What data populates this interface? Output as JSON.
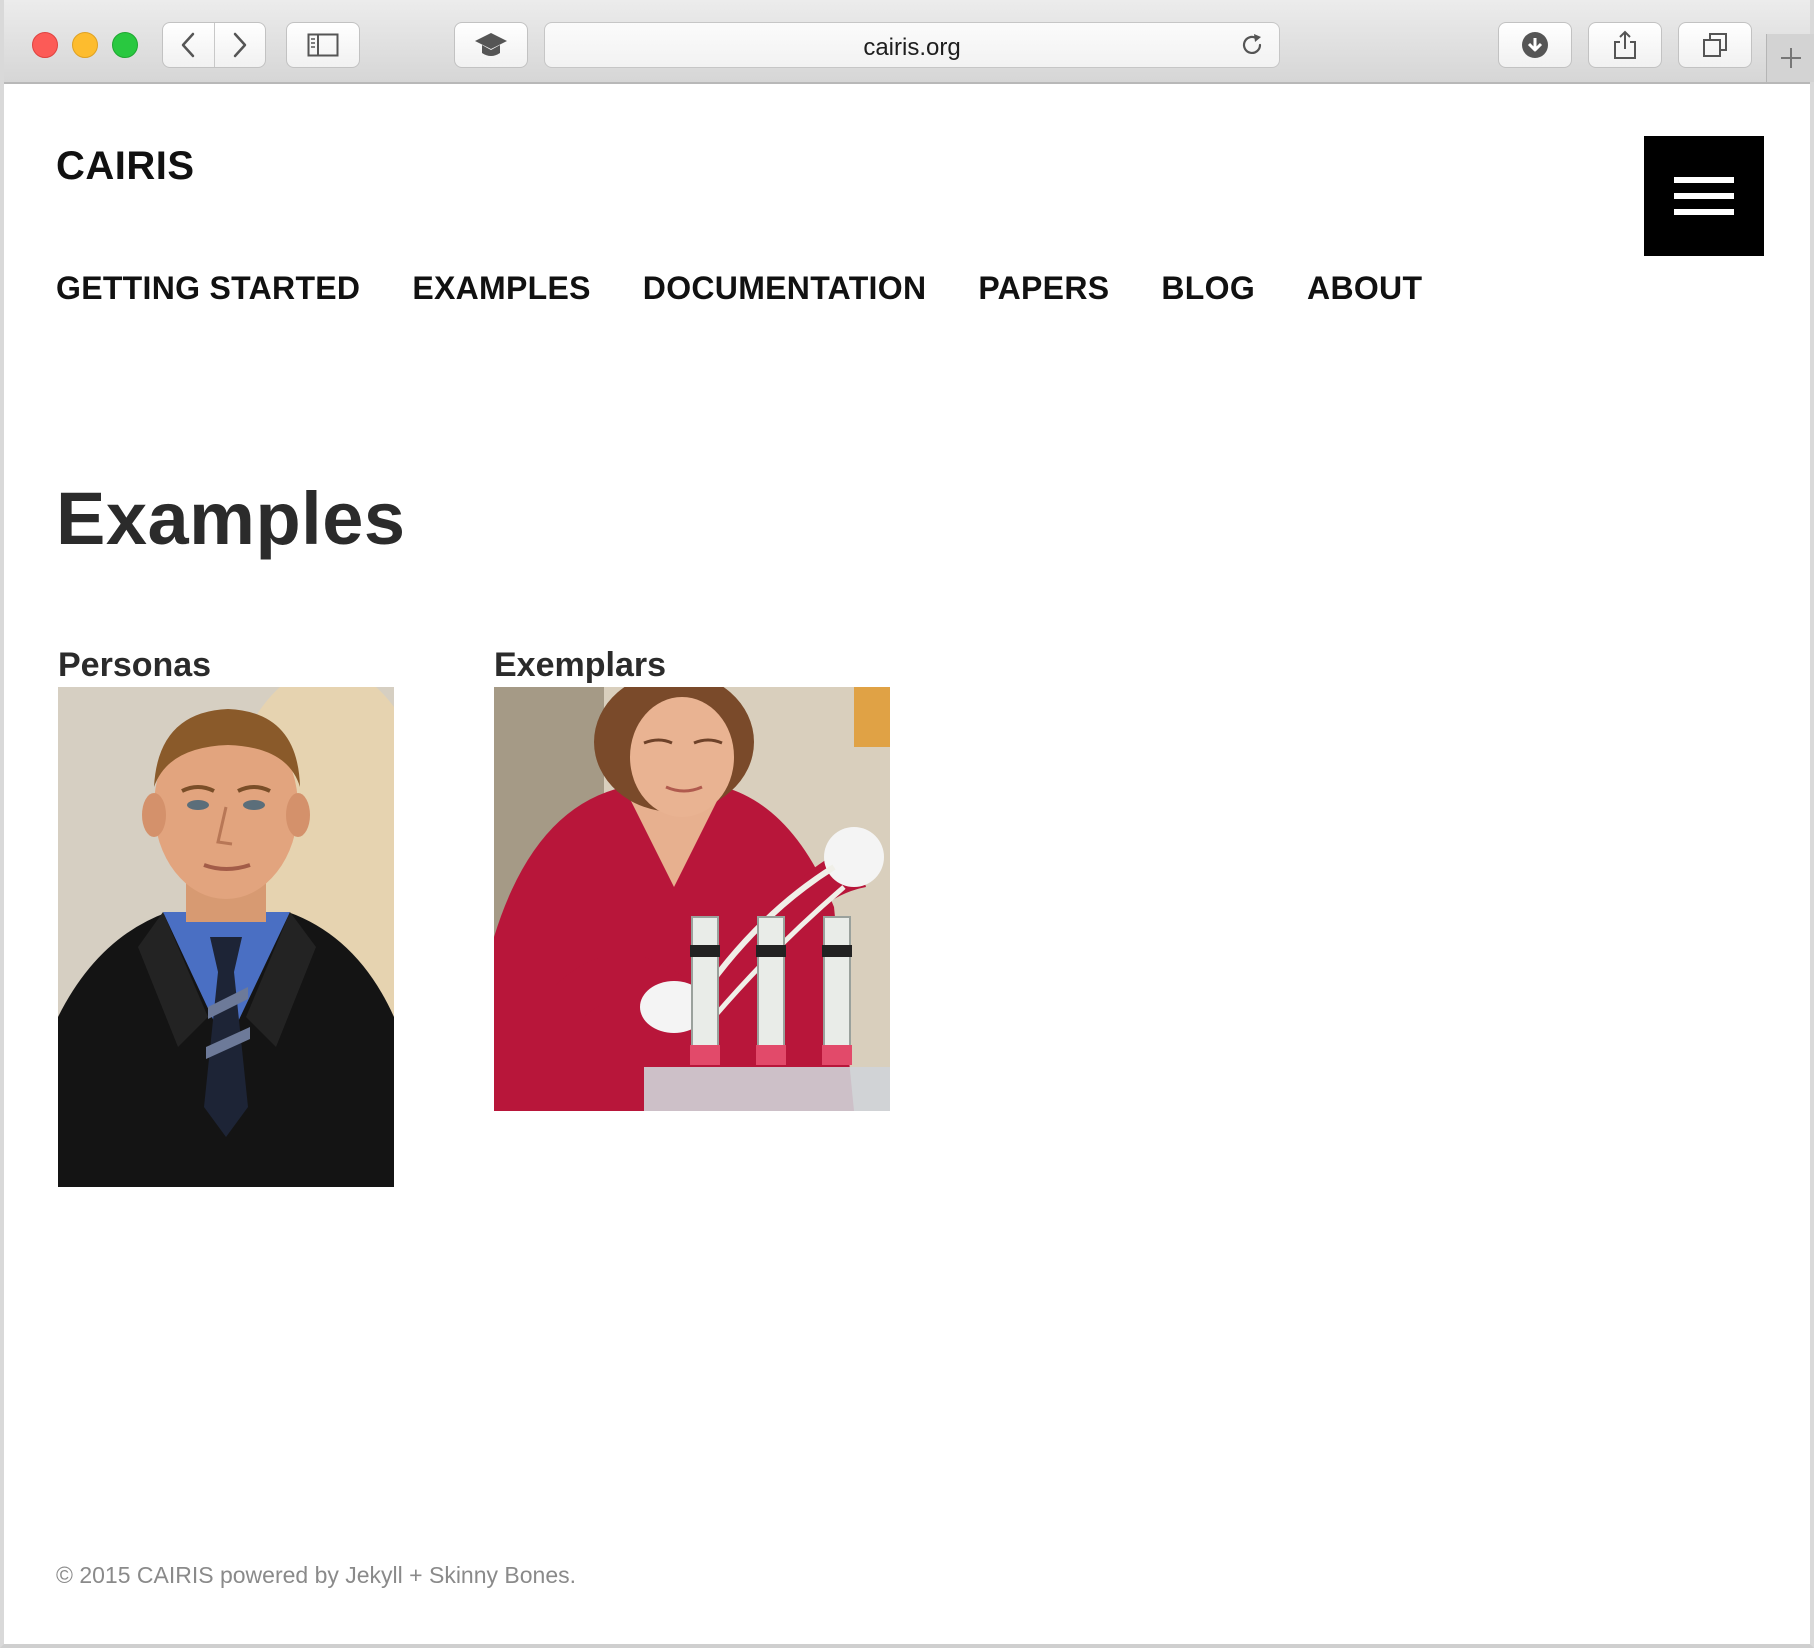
{
  "browser": {
    "url": "cairis.org",
    "icons": {
      "back": "chevron-left-icon",
      "forward": "chevron-right-icon",
      "sidebar": "sidebar-icon",
      "extension": "graduation-cap-icon",
      "reload": "reload-icon",
      "downloads": "download-icon",
      "share": "share-icon",
      "tabs": "tabs-overview-icon",
      "new_tab": "plus-icon"
    }
  },
  "site": {
    "title": "CAIRIS",
    "menu_icon": "hamburger-icon",
    "nav": [
      {
        "label": "GETTING STARTED"
      },
      {
        "label": "EXAMPLES"
      },
      {
        "label": "DOCUMENTATION"
      },
      {
        "label": "PAPERS"
      },
      {
        "label": "BLOG"
      },
      {
        "label": "ABOUT"
      }
    ]
  },
  "main": {
    "heading": "Examples",
    "cards": [
      {
        "title": "Personas",
        "image": "portrait-photo"
      },
      {
        "title": "Exemplars",
        "image": "lab-photo"
      }
    ]
  },
  "footer": {
    "text": "© 2015 CAIRIS powered by Jekyll + Skinny Bones."
  },
  "colors": {
    "text": "#111111",
    "heading": "#2b2b2b",
    "footer_text": "#8a8a8a",
    "menu_button": "#000000"
  }
}
